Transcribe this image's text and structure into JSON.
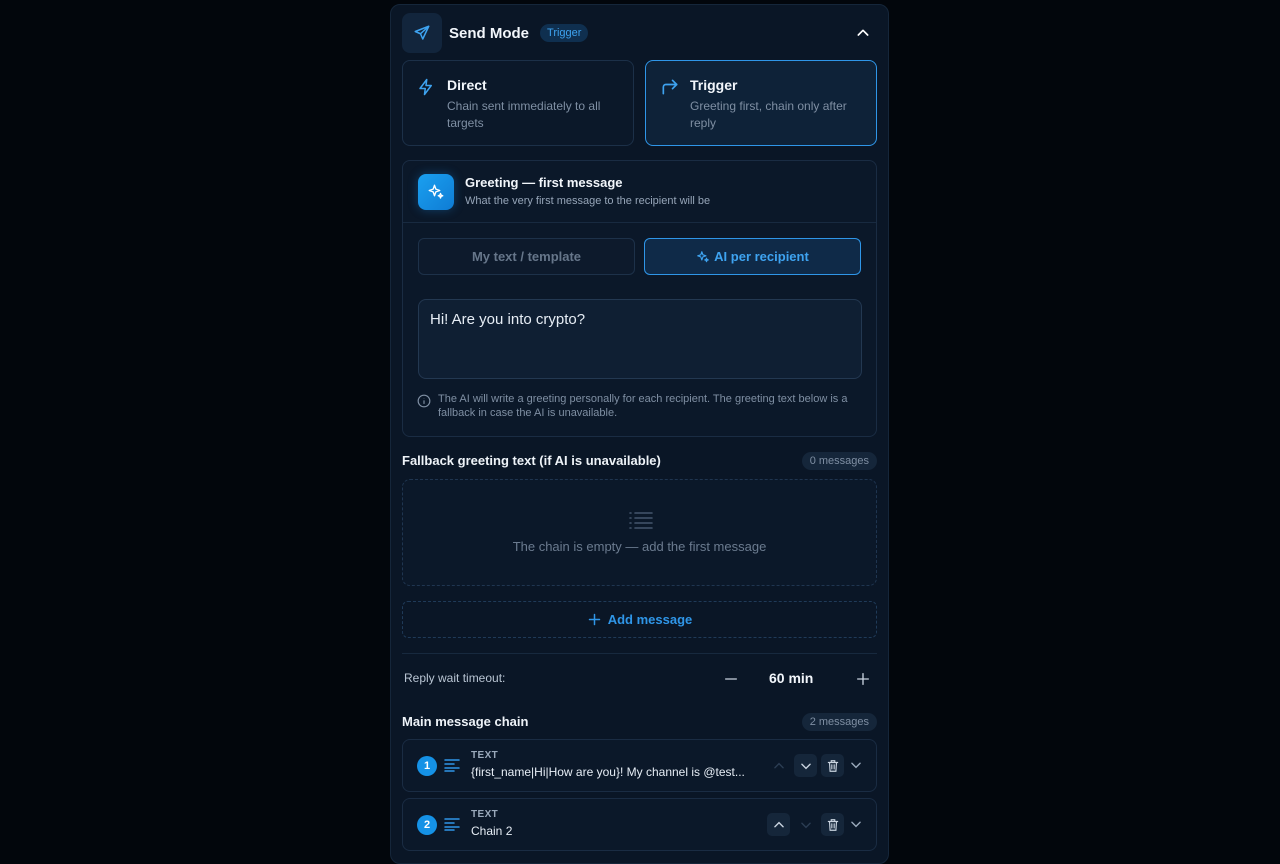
{
  "header": {
    "title": "Send Mode",
    "badge": "Trigger"
  },
  "modes": [
    {
      "title": "Direct",
      "desc": "Chain sent immediately to all targets",
      "icon": "bolt-icon",
      "active": false
    },
    {
      "title": "Trigger",
      "desc": "Greeting first, chain only after reply",
      "icon": "forward-arrow-icon",
      "active": true
    }
  ],
  "greeting": {
    "title": "Greeting — first message",
    "subtitle": "What the very first message to the recipient will be",
    "tab_template": "My text / template",
    "tab_ai": "AI per recipient",
    "text": "Hi! Are you into crypto?",
    "info": "The AI will write a greeting personally for each recipient. The greeting text below is a fallback in case the AI is unavailable."
  },
  "fallback": {
    "title": "Fallback greeting text (if AI is unavailable)",
    "count": "0 messages",
    "empty_text": "The chain is empty — add the first message",
    "add_label": "Add message"
  },
  "timeout": {
    "label": "Reply wait timeout:",
    "value": "60 min"
  },
  "main_chain": {
    "title": "Main message chain",
    "count": "2 messages",
    "items": [
      {
        "num": "1",
        "type": "TEXT",
        "text": "{first_name|Hi|How are you}! My channel is @test..."
      },
      {
        "num": "2",
        "type": "TEXT",
        "text": "Chain 2"
      }
    ]
  },
  "colors": {
    "accent": "#2f96e8",
    "background": "#02060c",
    "panel": "#0a1626"
  }
}
